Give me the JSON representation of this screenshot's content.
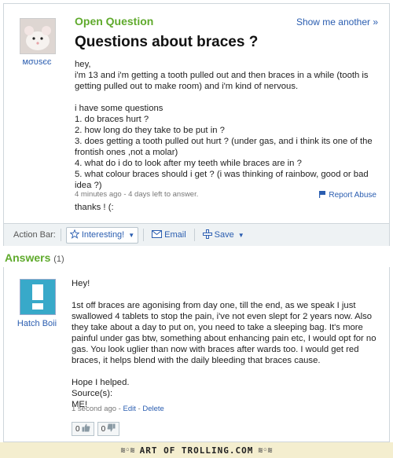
{
  "question": {
    "header_label": "Open Question",
    "show_another": "Show me another »",
    "title": "Questions about braces ?",
    "asker": "мσυѕєє",
    "body": "hey,\ni'm 13 and i'm getting a tooth pulled out and then braces in a while (tooth is getting pulled out to make room) and i'm kind of nervous.\n\ni have some questions\n1. do braces hurt ?\n2. how long do they take to be put in ?\n3. does getting a tooth pulled out hurt ? (under gas, and i think its one of the frontish ones ,not a molar)\n4. what do i do to look after my teeth while braces are in ?\n5. what colour braces should i get ? (i was thinking of rainbow, good or bad idea ?)\n\nthanks ! (:",
    "meta": "4 minutes ago - 4 days left to answer.",
    "report": "Report Abuse"
  },
  "action_bar": {
    "label": "Action Bar:",
    "interesting": "Interesting!",
    "email": "Email",
    "save": "Save"
  },
  "answers": {
    "heading": "Answers",
    "count": "(1)",
    "items": [
      {
        "user": "Hatch Boii",
        "body": "Hey!\n\n1st off braces are agonising from day one, till the end, as we speak I just swallowed 4 tablets to stop the pain, i've not even slept for 2 years now. Also they take about a day to put on, you need to take a sleeping bag. It's more painful under gas btw, something about enhancing pain etc, I would opt for no gas. You look uglier than now with braces after wards too. I would get red braces, it helps blend with the daily bleeding that braces cause.\n\nHope I helped.\nSource(s):\nME!",
        "time": "1 second ago",
        "edit": "Edit",
        "delete": "Delete",
        "thumbs_up": "0",
        "thumbs_down": "0"
      }
    ]
  },
  "footer": {
    "text": "ART OF TROLLING.COM"
  }
}
